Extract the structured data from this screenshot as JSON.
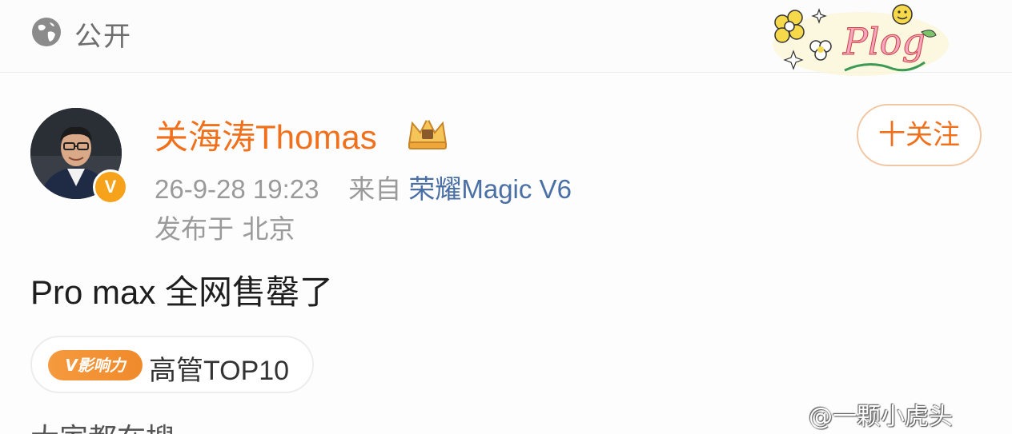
{
  "header": {
    "visibility_label": "公开",
    "sticker_text": "Plog"
  },
  "post": {
    "username": "关海涛Thomas",
    "verified_badge": "V",
    "follow_label": "十关注",
    "timestamp": "26-9-28 19:23",
    "from_label": "来自",
    "device": "荣耀Magic V6",
    "location": "发布于 北京",
    "content": "Pro max 全网售罄了",
    "influence": {
      "badge_label": "V影响力",
      "text": "高管TOP10"
    },
    "cutoff_text": "大家都在搜"
  },
  "watermark": "@一颗小虎头",
  "colors": {
    "username": "#f0701c",
    "device_link": "#4a6fa5",
    "verified": "#f7a21b"
  },
  "icons": {
    "globe": "globe-icon",
    "crown": "crown-icon"
  }
}
